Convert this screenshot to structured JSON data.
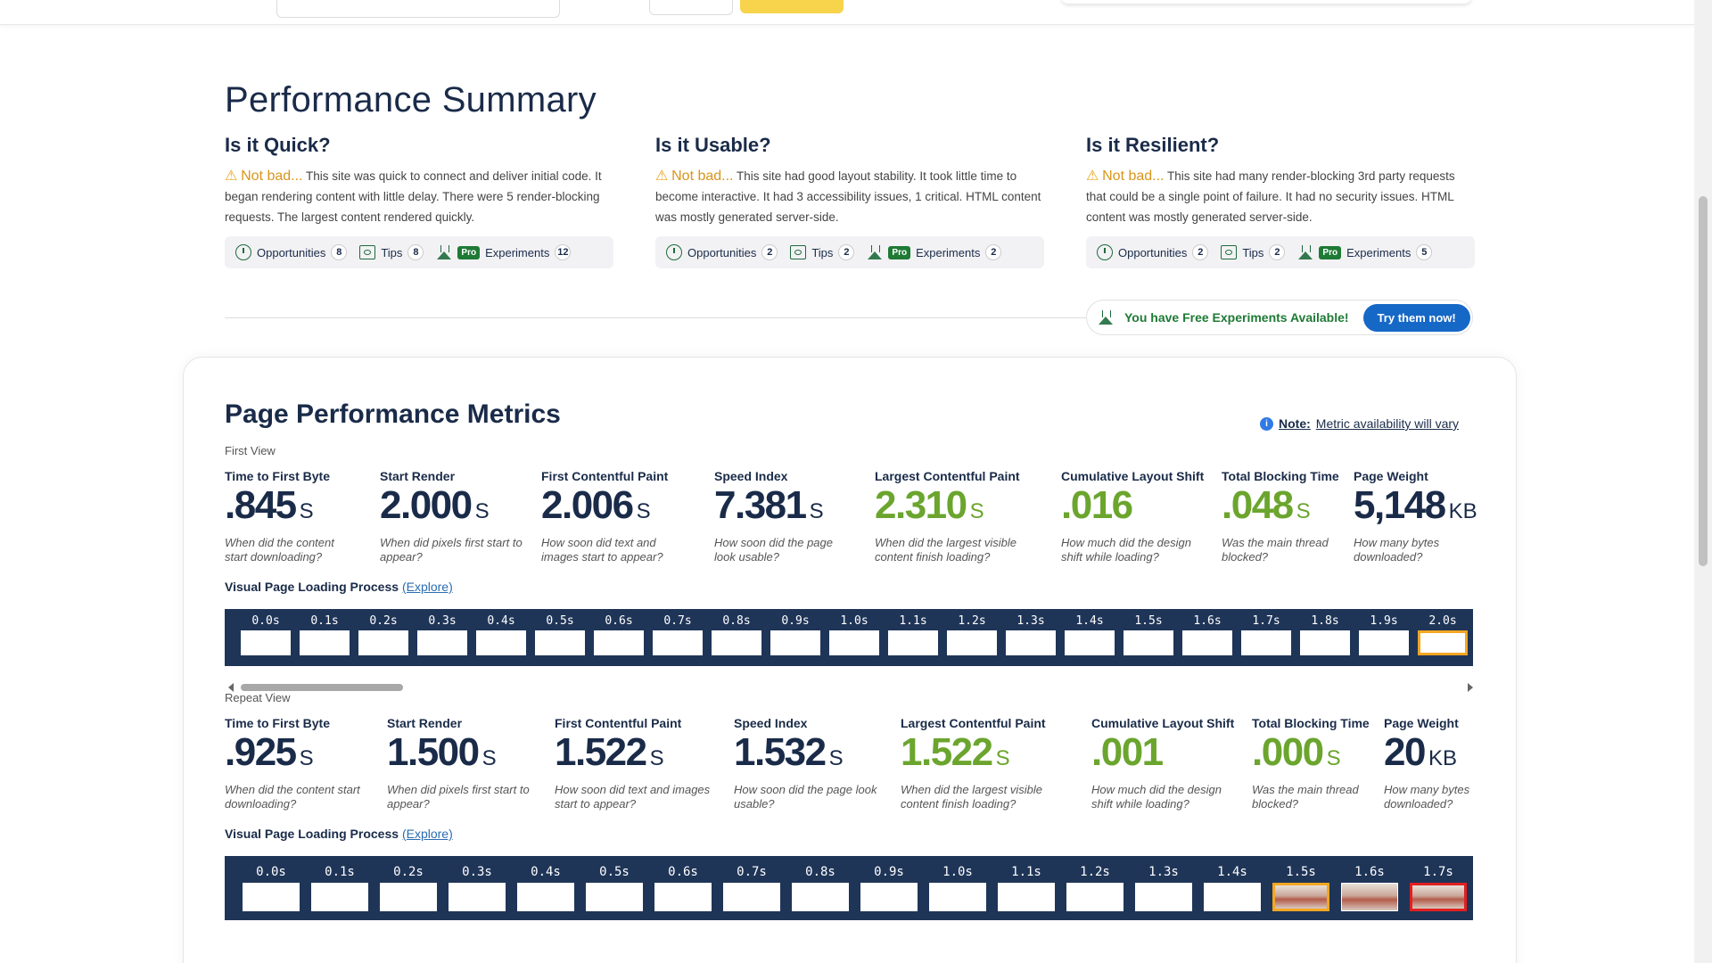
{
  "performance_summary": {
    "title": "Performance Summary",
    "columns": [
      {
        "heading": "Is it Quick?",
        "status": "Not bad...",
        "text": "This site was quick to connect and deliver initial code. It began rendering content with little delay. There were 5 render-blocking requests. The largest content rendered quickly.",
        "opportunities_label": "Opportunities",
        "opportunities": "8",
        "tips_label": "Tips",
        "tips": "8",
        "pro_label": "Pro",
        "experiments_label": "Experiments",
        "experiments": "12"
      },
      {
        "heading": "Is it Usable?",
        "status": "Not bad...",
        "text": "This site had good layout stability. It took little time to become interactive. It had 3 accessibility issues, 1 critical. HTML content was mostly generated server-side.",
        "opportunities_label": "Opportunities",
        "opportunities": "2",
        "tips_label": "Tips",
        "tips": "2",
        "pro_label": "Pro",
        "experiments_label": "Experiments",
        "experiments": "2"
      },
      {
        "heading": "Is it Resilient?",
        "status": "Not bad...",
        "text": "This site had many render-blocking 3rd party requests that could be a single point of failure. It had no security issues. HTML content was mostly generated server-side.",
        "opportunities_label": "Opportunities",
        "opportunities": "2",
        "tips_label": "Tips",
        "tips": "2",
        "pro_label": "Pro",
        "experiments_label": "Experiments",
        "experiments": "5"
      }
    ],
    "free_experiments_text": "You have Free Experiments Available!",
    "try_button": "Try them now!"
  },
  "metrics": {
    "title": "Page Performance Metrics",
    "note_label": "Note:",
    "note_text": "Metric availability will vary",
    "first_view": {
      "label": "First View",
      "items": [
        {
          "label": "Time to First Byte",
          "value": ".845",
          "unit": "S",
          "desc": "When did the content start downloading?"
        },
        {
          "label": "Start Render",
          "value": "2.000",
          "unit": "S",
          "desc": "When did pixels first start to appear?"
        },
        {
          "label": "First Contentful Paint",
          "value": "2.006",
          "unit": "S",
          "desc": "How soon did text and images start to appear?"
        },
        {
          "label": "Speed Index",
          "value": "7.381",
          "unit": "S",
          "desc": "How soon did the page look usable?"
        },
        {
          "label": "Largest Contentful Paint",
          "value": "2.310",
          "unit": "S",
          "desc": "When did the largest visible content finish loading?"
        },
        {
          "label": "Cumulative Layout Shift",
          "value": ".016",
          "unit": "",
          "desc": "How much did the design shift while loading?"
        },
        {
          "label": "Total Blocking Time",
          "value": ".048",
          "unit": "S",
          "desc": "Was the main thread blocked?"
        },
        {
          "label": "Page Weight",
          "value": "5,148",
          "unit": "KB",
          "desc": "How many bytes downloaded?"
        }
      ],
      "visual_label": "Visual Page Loading Process",
      "explore": "(Explore)",
      "frames": [
        "0.0s",
        "0.1s",
        "0.2s",
        "0.3s",
        "0.4s",
        "0.5s",
        "0.6s",
        "0.7s",
        "0.8s",
        "0.9s",
        "1.0s",
        "1.1s",
        "1.2s",
        "1.3s",
        "1.4s",
        "1.5s",
        "1.6s",
        "1.7s",
        "1.8s",
        "1.9s",
        "2.0s"
      ]
    },
    "repeat_view": {
      "label": "Repeat View",
      "items": [
        {
          "label": "Time to First Byte",
          "value": ".925",
          "unit": "S",
          "desc": "When did the content start downloading?"
        },
        {
          "label": "Start Render",
          "value": "1.500",
          "unit": "S",
          "desc": "When did pixels first start to appear?"
        },
        {
          "label": "First Contentful Paint",
          "value": "1.522",
          "unit": "S",
          "desc": "How soon did text and images start to appear?"
        },
        {
          "label": "Speed Index",
          "value": "1.532",
          "unit": "S",
          "desc": "How soon did the page look usable?"
        },
        {
          "label": "Largest Contentful Paint",
          "value": "1.522",
          "unit": "S",
          "desc": "When did the largest visible content finish loading?"
        },
        {
          "label": "Cumulative Layout Shift",
          "value": ".001",
          "unit": "",
          "desc": "How much did the design shift while loading?"
        },
        {
          "label": "Total Blocking Time",
          "value": ".000",
          "unit": "S",
          "desc": "Was the main thread blocked?"
        },
        {
          "label": "Page Weight",
          "value": "20",
          "unit": "KB",
          "desc": "How many bytes downloaded?"
        }
      ],
      "visual_label": "Visual Page Loading Process",
      "explore": "(Explore)",
      "frames": [
        "0.0s",
        "0.1s",
        "0.2s",
        "0.3s",
        "0.4s",
        "0.5s",
        "0.6s",
        "0.7s",
        "0.8s",
        "0.9s",
        "1.0s",
        "1.1s",
        "1.2s",
        "1.3s",
        "1.4s",
        "1.5s",
        "1.6s",
        "1.7s"
      ]
    }
  },
  "colors": {
    "heading": "#1a2b49",
    "good_metric": "#6ba52e",
    "warning": "#e8a317",
    "strip_bg": "#1f3558",
    "try_button": "#1668c6",
    "pro_badge": "#1e7a35"
  }
}
